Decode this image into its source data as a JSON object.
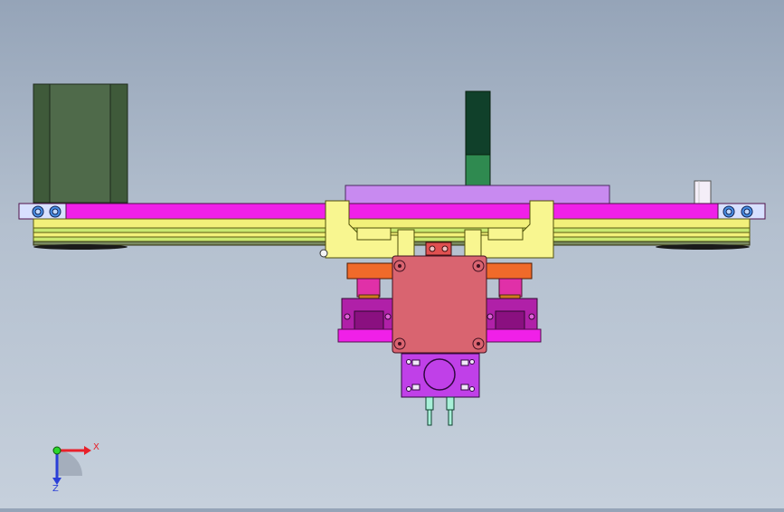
{
  "viewport": {
    "background_top": "#95a4b8",
    "background_bottom": "#c6d0dc"
  },
  "triad": {
    "x_label": "X",
    "z_label": "Z",
    "x_color": "#e8202a",
    "z_color": "#2a3fd8",
    "y_color": "#2bd62b"
  },
  "colors": {
    "motor_body": "#4f6a4a",
    "main_beam": "#f020e8",
    "rail_yellow": "#f2f07a",
    "rail_green": "#c9e870",
    "top_plate": "#c88af0",
    "carriage_yellow": "#f8f690",
    "salmon_block": "#d96470",
    "orange_block": "#f06a2a",
    "purple_block": "#b020a8",
    "violet_gearbox": "#c040e8",
    "dark_green_sensor": "#10402a",
    "mid_green_sensor": "#2f8a50",
    "bolt_blue": "#8fb8f0"
  }
}
